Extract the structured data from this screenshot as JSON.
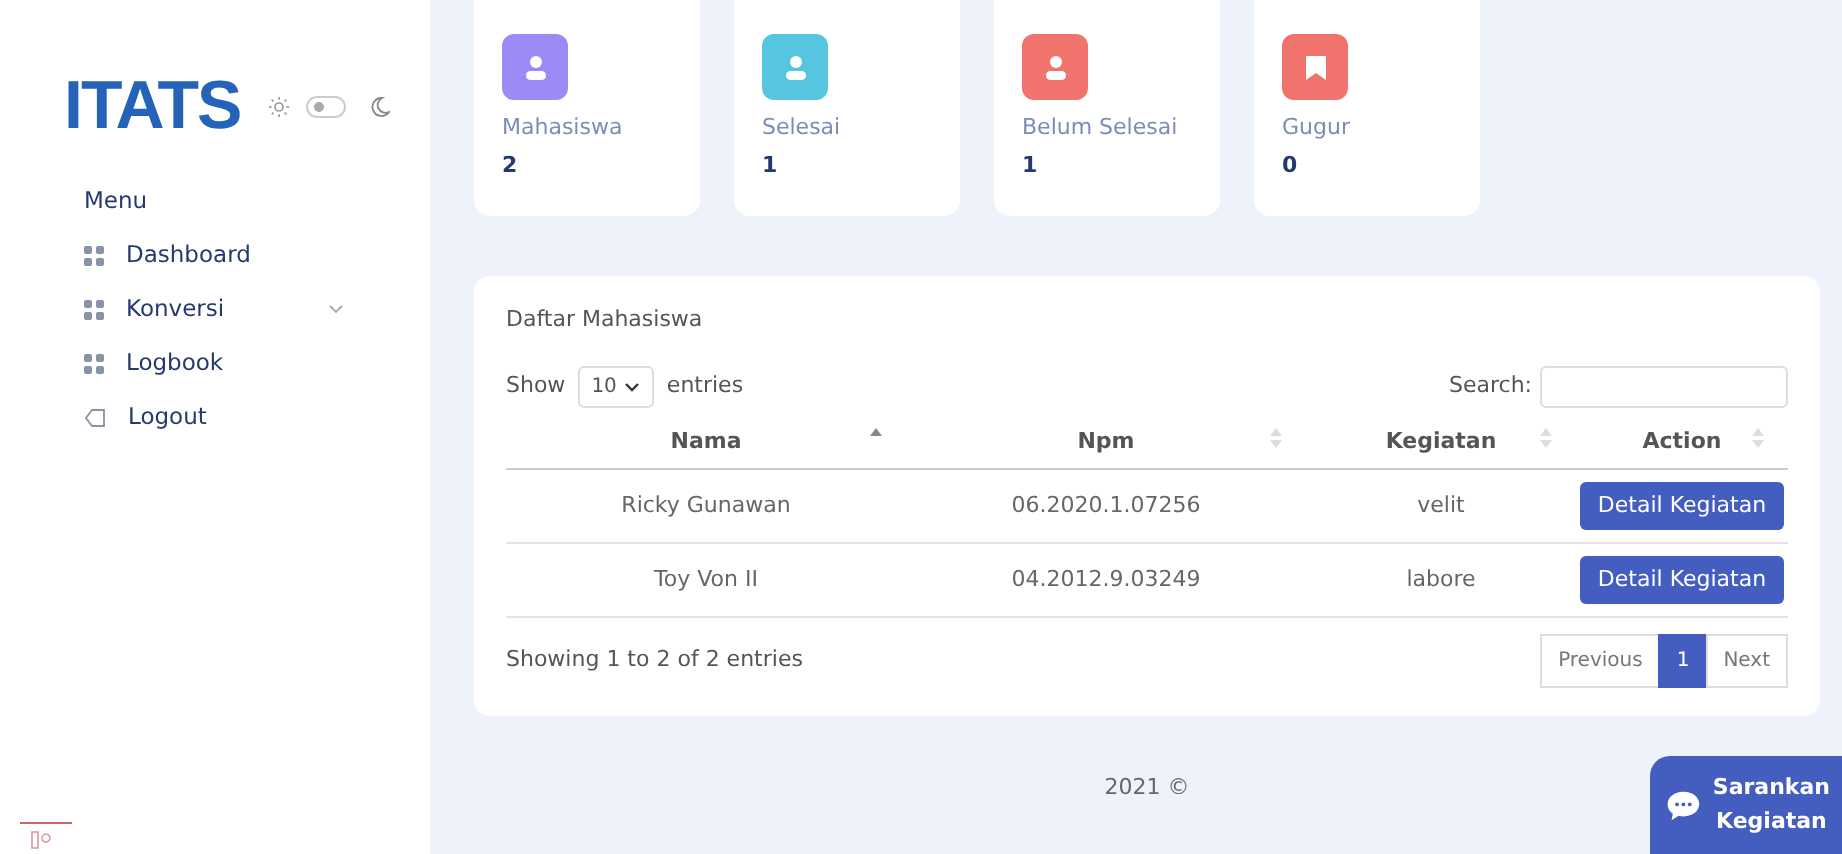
{
  "sidebar": {
    "logo": "ITATS",
    "dark_mode": false,
    "section_title": "Menu",
    "items": [
      {
        "label": "Dashboard",
        "kind": "page"
      },
      {
        "label": "Konversi",
        "kind": "submenu"
      },
      {
        "label": "Logbook",
        "kind": "page"
      },
      {
        "label": "Logout",
        "kind": "logout"
      }
    ]
  },
  "stats": [
    {
      "label": "Mahasiswa",
      "value": "2",
      "kind": "count",
      "color": "#9b8cf5"
    },
    {
      "label": "Selesai",
      "value": "1",
      "kind": "count",
      "color": "#56c5e0"
    },
    {
      "label": "Belum Selesai",
      "value": "1",
      "kind": "count",
      "color": "#f1736e"
    },
    {
      "label": "Gugur",
      "value": "0",
      "kind": "loss",
      "color": "#f1736e"
    }
  ],
  "table": {
    "title": "Daftar Mahasiswa",
    "show_label": "Show",
    "page_size": "10",
    "entries_label": "entries",
    "search_label": "Search:",
    "columns": [
      {
        "label": "Nama",
        "sorted": true
      },
      {
        "label": "Npm",
        "sorted": false
      },
      {
        "label": "Kegiatan",
        "sorted": false
      },
      {
        "label": "Action",
        "sorted": false
      }
    ],
    "rows": [
      {
        "nama": "Ricky Gunawan",
        "npm": "06.2020.1.07256",
        "kegiatan": "velit",
        "action": "Detail Kegiatan"
      },
      {
        "nama": "Toy Von II",
        "npm": "04.2012.9.03249",
        "kegiatan": "labore",
        "action": "Detail Kegiatan"
      }
    ],
    "info": "Showing 1 to 2 of 2 entries",
    "pagination": [
      {
        "label": "Previous",
        "selected": false
      },
      {
        "label": "1",
        "selected": true
      },
      {
        "label": "Next",
        "selected": false
      }
    ]
  },
  "footer": "2021 ©",
  "floating_button": {
    "lines": [
      "Sarankan",
      "Kegiatan"
    ]
  }
}
